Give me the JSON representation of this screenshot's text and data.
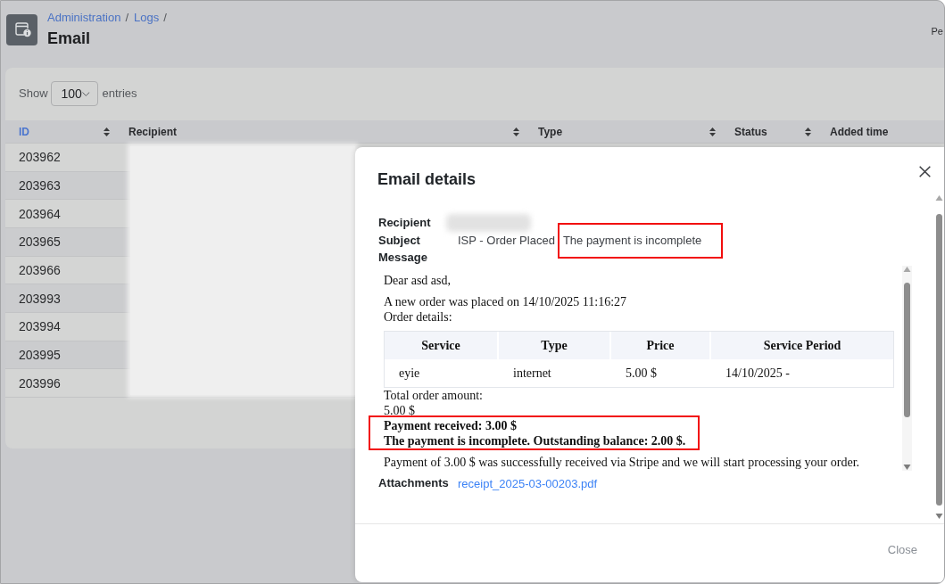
{
  "header": {
    "breadcrumb": [
      {
        "label": "Administration",
        "separator": "/"
      },
      {
        "label": "Logs",
        "separator": "/"
      }
    ],
    "title": "Email",
    "side_label": "Pe"
  },
  "entries": {
    "before": "Show",
    "value": "100",
    "after": "entries"
  },
  "table": {
    "columns": [
      {
        "label": "ID",
        "sorted": true
      },
      {
        "label": "Recipient",
        "sorted": false
      },
      {
        "label": "Type",
        "sorted": false
      },
      {
        "label": "Status",
        "sorted": false
      },
      {
        "label": "Added time",
        "sorted": false
      }
    ],
    "rows": [
      {
        "id": "203962"
      },
      {
        "id": "203963"
      },
      {
        "id": "203964"
      },
      {
        "id": "203965"
      },
      {
        "id": "203966"
      },
      {
        "id": "203993"
      },
      {
        "id": "203994"
      },
      {
        "id": "203995"
      },
      {
        "id": "203996"
      }
    ],
    "recipients_redacted": true
  },
  "dialog": {
    "title": "Email details",
    "recipient": {
      "label": "Recipient",
      "redacted": true
    },
    "subject": {
      "label": "Subject",
      "parts": [
        {
          "text": "ISP - Order Placed",
          "highlighted": false
        },
        {
          "text": "The payment is incomplete",
          "highlighted": true
        }
      ]
    },
    "message": {
      "label": "Message",
      "body": [
        {
          "kind": "paragraph",
          "lines": [
            "Dear asd asd,"
          ]
        },
        {
          "kind": "paragraph",
          "lines": [
            "A new order was placed on 14/10/2025 11:16:27",
            "Order details:"
          ]
        },
        {
          "kind": "table",
          "columns": [
            "Service",
            "Type",
            "Price",
            "Service Period"
          ],
          "rows": [
            [
              "eyie",
              "internet",
              "5.00 $",
              "14/10/2025 -"
            ]
          ]
        },
        {
          "kind": "lines",
          "lines": [
            "Total order amount:",
            "5.00 $"
          ]
        },
        {
          "kind": "notice",
          "highlighted": true,
          "lines": [
            "Payment received: 3.00 $",
            "The payment is incomplete. Outstanding balance: 2.00 $."
          ]
        },
        {
          "kind": "paragraph",
          "lines": [
            "Payment of 3.00 $ was successfully received via Stripe and we will start processing your order."
          ]
        }
      ]
    },
    "attachments": {
      "label": "Attachments",
      "files": [
        "receipt_2025-03-00203.pdf"
      ]
    },
    "buttons": [
      "Close"
    ]
  }
}
